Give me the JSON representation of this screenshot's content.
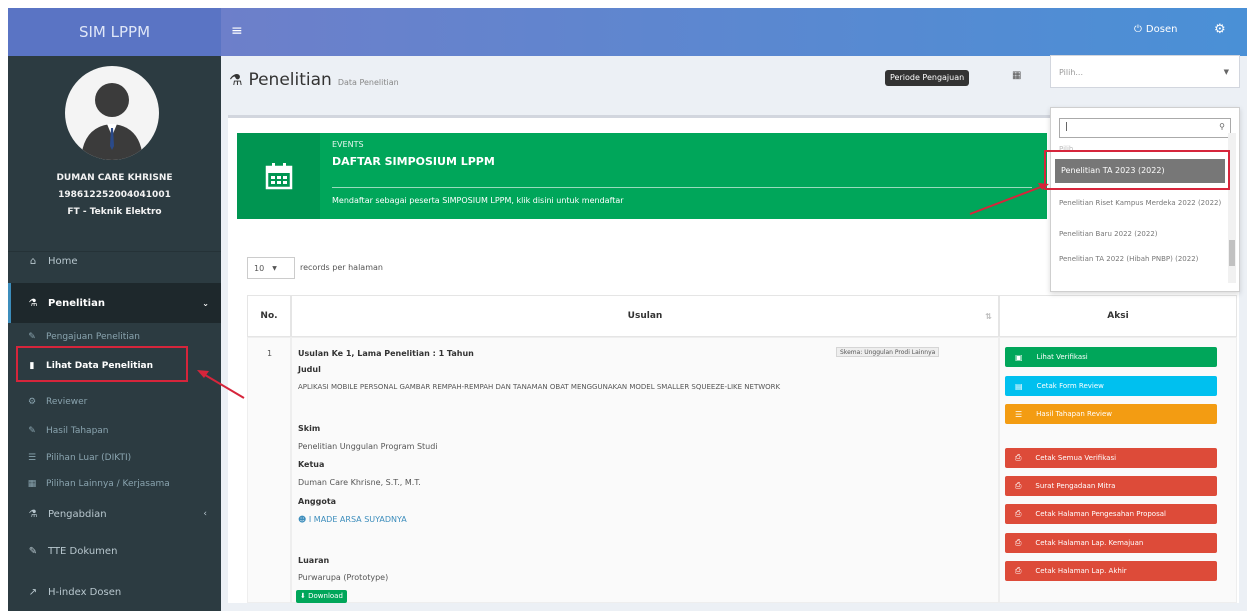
{
  "app": {
    "brand": "SIM LPPM"
  },
  "user": {
    "name": "DUMAN CARE KHRISNE",
    "nip": "198612252004041001",
    "unit": "FT - Teknik Elektro"
  },
  "sidebar": {
    "home": "Home",
    "penelitian": "Penelitian",
    "sub": [
      "Pengajuan Penelitian",
      "Lihat Data Penelitian",
      "Reviewer",
      "Hasil Tahapan",
      "Pilihan Luar (DIKTI)",
      "Pilihan Lainnya / Kerjasama"
    ],
    "pengabdian": "Pengabdian",
    "tte": "TTE Dokumen",
    "hindex": "H-index Dosen"
  },
  "navbar": {
    "menu_icon": "bars-icon",
    "dosen_label": "Dosen"
  },
  "header": {
    "title": "Penelitian",
    "subtitle": "Data Penelitian",
    "periode_label": "Periode Pengajuan"
  },
  "periode_select": {
    "placeholder": "Pilih...",
    "search_value": "|"
  },
  "dropdown": {
    "options": [
      "Pilih...",
      "Penelitian TA 2023 (2022)",
      "Penelitian Riset Kampus Merdeka 2022 (2022)",
      "Penelitian Baru 2022 (2022)",
      "Penelitian TA 2022 (Hibah PNBP) (2022)"
    ],
    "selected_index": 1
  },
  "callout": {
    "event": "EVENTS",
    "title": "DAFTAR SIMPOSIUM LPPM",
    "desc": "Mendaftar sebagai peserta SIMPOSIUM LPPM, klik disini untuk mendaftar"
  },
  "table_controls": {
    "length": "10",
    "records_text": "records per halaman"
  },
  "table": {
    "headers": [
      "No.",
      "Usulan",
      "Aksi"
    ],
    "row": {
      "no": "1",
      "usulan_title": "Usulan Ke 1, Lama Penelitian : 1 Tahun",
      "tag": "Skema: Unggulan Prodi Lainnya",
      "judul_label": "Judul",
      "judul": "APLIKASI MOBILE PERSONAL GAMBAR REMPAH-REMPAH DAN TANAMAN OBAT MENGGUNAKAN MODEL SMALLER SQUEEZE-LIKE NETWORK",
      "skim_label": "Skim",
      "skim": "Penelitian Unggulan Program Studi",
      "ketua_label": "Ketua",
      "ketua": "Duman Care Khrisne, S.T., M.T.",
      "anggota_label": "Anggota",
      "anggota": "I MADE ARSA SUYADNYA",
      "luaran_label": "Luaran",
      "luaran": "Purwarupa (Prototype)",
      "download": "Download"
    },
    "aksi": [
      "Lihat Verifikasi",
      "Cetak Form Review",
      "Hasil Tahapan Review",
      "Cetak Semua Verifikasi",
      "Surat Pengadaan Mitra",
      "Cetak Halaman Pengesahan Proposal",
      "Cetak Halaman Lap. Kemajuan",
      "Cetak Halaman Lap. Akhir"
    ]
  },
  "colors": {
    "sidebar": "#2c3b41",
    "brand": "#5a74c4",
    "callout": "#00a65a",
    "highlight": "#d6253b"
  }
}
